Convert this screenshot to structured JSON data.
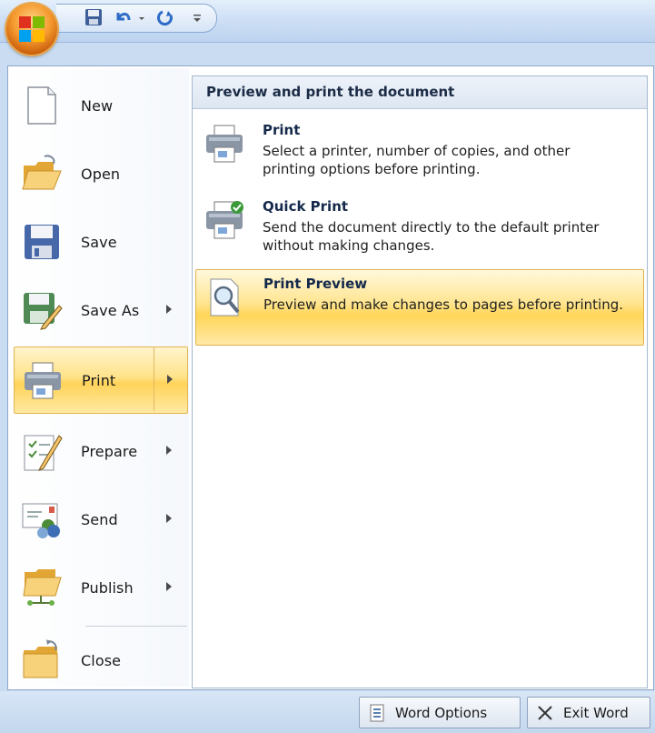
{
  "quick_access": {
    "icons": [
      "save-icon",
      "undo-icon",
      "redo-icon",
      "customize-qat-icon"
    ]
  },
  "menu": {
    "items": [
      {
        "label": "New",
        "icon": "new-document-icon",
        "has_submenu": false
      },
      {
        "label": "Open",
        "icon": "open-folder-icon",
        "has_submenu": false
      },
      {
        "label": "Save",
        "icon": "save-icon",
        "has_submenu": false
      },
      {
        "label": "Save As",
        "icon": "save-as-icon",
        "has_submenu": true
      },
      {
        "label": "Print",
        "icon": "printer-icon",
        "has_submenu": true,
        "active": true
      },
      {
        "label": "Prepare",
        "icon": "prepare-icon",
        "has_submenu": true
      },
      {
        "label": "Send",
        "icon": "send-icon",
        "has_submenu": true
      },
      {
        "label": "Publish",
        "icon": "publish-icon",
        "has_submenu": true
      },
      {
        "label": "Close",
        "icon": "close-folder-icon",
        "has_submenu": false
      }
    ]
  },
  "submenu": {
    "header": "Preview and print the document",
    "items": [
      {
        "title": "Print",
        "description": "Select a printer, number of copies, and other printing options before printing.",
        "icon": "printer-icon"
      },
      {
        "title": "Quick Print",
        "description": "Send the document directly to the default printer without making changes.",
        "icon": "quick-print-icon"
      },
      {
        "title": "Print Preview",
        "description": "Preview and make changes to pages before printing.",
        "icon": "print-preview-icon",
        "active": true
      }
    ]
  },
  "footer": {
    "word_options": "Word Options",
    "exit_word": "Exit Word"
  },
  "colors": {
    "highlight": "#ffd35a",
    "frame": "#8ea8c9"
  }
}
